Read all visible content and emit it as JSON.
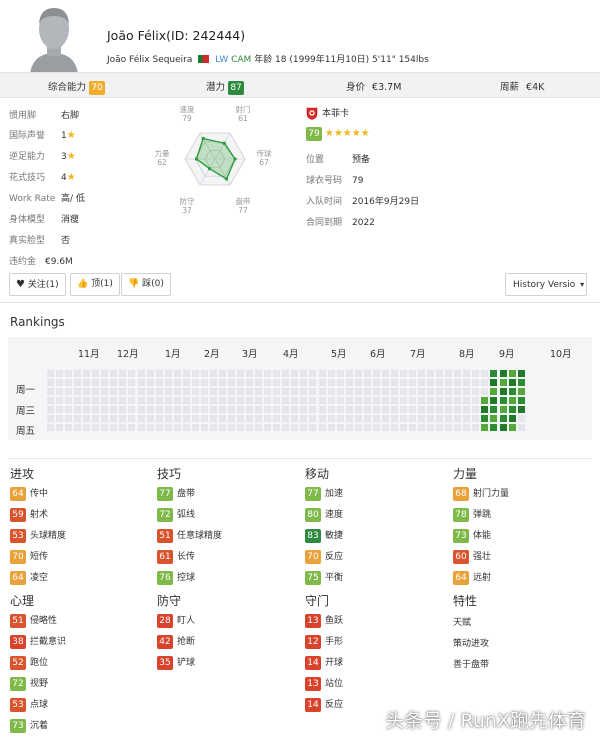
{
  "player": {
    "name_id": "João Félix(ID: 242444)",
    "full_name": "João Félix Sequeira",
    "positions": [
      "LW",
      "CAM"
    ],
    "meta": "年龄 18 (1999年11月10日) 5'11\" 154lbs"
  },
  "statbar": [
    {
      "label": "综合能力",
      "value": "70",
      "color": "#f0ad2e"
    },
    {
      "label": "潜力",
      "value": "87",
      "color": "#2d8a3e"
    },
    {
      "label": "身价",
      "value": "€3.7M"
    },
    {
      "label": "周薪",
      "value": "€4K"
    }
  ],
  "info_left": [
    {
      "key": "惯用脚",
      "value": "右脚"
    },
    {
      "key": "国际声誉",
      "value": "1"
    },
    {
      "key": "逆足能力",
      "value": "3"
    },
    {
      "key": "花式技巧",
      "value": "4"
    },
    {
      "key": "Work Rate",
      "value": "高/ 低"
    },
    {
      "key": "身体模型",
      "value": "消瘦"
    },
    {
      "key": "真实脸型",
      "value": "否"
    },
    {
      "key": "违约金",
      "value": "€9.6M"
    }
  ],
  "radar": {
    "labels": [
      {
        "name": "速度",
        "value": "79"
      },
      {
        "name": "射门",
        "value": "61"
      },
      {
        "name": "传球",
        "value": "67"
      },
      {
        "name": "盘带",
        "value": "77"
      },
      {
        "name": "防守",
        "value": "37"
      },
      {
        "name": "力量",
        "value": "62"
      }
    ],
    "values": [
      79,
      61,
      67,
      77,
      37,
      62
    ],
    "max": 100
  },
  "club": {
    "name": "本菲卡",
    "rating": "79",
    "stars": "★★★★★",
    "rows": [
      {
        "key": "位置",
        "value": "预备"
      },
      {
        "key": "球衣号码",
        "value": "79"
      },
      {
        "key": "入队时间",
        "value": "2016年9月29日"
      },
      {
        "key": "合同到期",
        "value": "2022"
      }
    ]
  },
  "buttons": {
    "follow": "关注(1)",
    "like": "顶(1)",
    "dislike": "踩(0)",
    "history": "History Versio"
  },
  "rankings": {
    "title": "Rankings",
    "months": [
      "11月",
      "12月",
      "1月",
      "2月",
      "3月",
      "4月",
      "5月",
      "6月",
      "7月",
      "8月",
      "9月",
      "10月"
    ],
    "weekdays": [
      "周一",
      "周三",
      "周五"
    ]
  },
  "attribute_groups": [
    {
      "title": "进攻",
      "items": [
        {
          "v": "64",
          "name": "传中",
          "color": "#e9a13a"
        },
        {
          "v": "59",
          "name": "射术",
          "color": "#d9542c"
        },
        {
          "v": "53",
          "name": "头球精度",
          "color": "#d9542c"
        },
        {
          "v": "70",
          "name": "短传",
          "color": "#e9a13a"
        },
        {
          "v": "64",
          "name": "凌空",
          "color": "#e9a13a"
        }
      ]
    },
    {
      "title": "技巧",
      "items": [
        {
          "v": "77",
          "name": "盘带",
          "color": "#7fb949"
        },
        {
          "v": "72",
          "name": "弧线",
          "color": "#7fb949"
        },
        {
          "v": "51",
          "name": "任意球精度",
          "color": "#d9542c"
        },
        {
          "v": "61",
          "name": "长传",
          "color": "#d9542c"
        },
        {
          "v": "76",
          "name": "控球",
          "color": "#7fb949"
        }
      ]
    },
    {
      "title": "移动",
      "items": [
        {
          "v": "77",
          "name": "加速",
          "color": "#7fb949"
        },
        {
          "v": "80",
          "name": "速度",
          "color": "#7fb949"
        },
        {
          "v": "83",
          "name": "敏捷",
          "color": "#2d8a3e"
        },
        {
          "v": "70",
          "name": "反应",
          "color": "#e9a13a"
        },
        {
          "v": "75",
          "name": "平衡",
          "color": "#7fb949"
        }
      ]
    },
    {
      "title": "力量",
      "items": [
        {
          "v": "68",
          "name": "射门力量",
          "color": "#e9a13a"
        },
        {
          "v": "78",
          "name": "弹跳",
          "color": "#7fb949"
        },
        {
          "v": "73",
          "name": "体能",
          "color": "#7fb949"
        },
        {
          "v": "60",
          "name": "强壮",
          "color": "#d9542c"
        },
        {
          "v": "64",
          "name": "远射",
          "color": "#e9a13a"
        }
      ]
    },
    {
      "title": "心理",
      "items": [
        {
          "v": "51",
          "name": "侵略性",
          "color": "#d9542c"
        },
        {
          "v": "38",
          "name": "拦截意识",
          "color": "#d9422b"
        },
        {
          "v": "52",
          "name": "跑位",
          "color": "#d9542c"
        },
        {
          "v": "72",
          "name": "视野",
          "color": "#7fb949"
        },
        {
          "v": "53",
          "name": "点球",
          "color": "#d9542c"
        },
        {
          "v": "73",
          "name": "沉着",
          "color": "#7fb949"
        }
      ]
    },
    {
      "title": "防守",
      "items": [
        {
          "v": "28",
          "name": "盯人",
          "color": "#d9422b"
        },
        {
          "v": "42",
          "name": "抢断",
          "color": "#d9422b"
        },
        {
          "v": "35",
          "name": "铲球",
          "color": "#d9422b"
        }
      ]
    },
    {
      "title": "守门",
      "items": [
        {
          "v": "13",
          "name": "鱼跃",
          "color": "#d9422b"
        },
        {
          "v": "12",
          "name": "手形",
          "color": "#d9422b"
        },
        {
          "v": "14",
          "name": "开球",
          "color": "#d9422b"
        },
        {
          "v": "13",
          "name": "站位",
          "color": "#d9422b"
        },
        {
          "v": "14",
          "name": "反应",
          "color": "#d9422b"
        }
      ]
    }
  ],
  "traits": {
    "title": "特性",
    "items": [
      "天赋",
      "策动进攻",
      "善于盘带"
    ]
  },
  "watermark": "头条号 / RunX跑先体育"
}
